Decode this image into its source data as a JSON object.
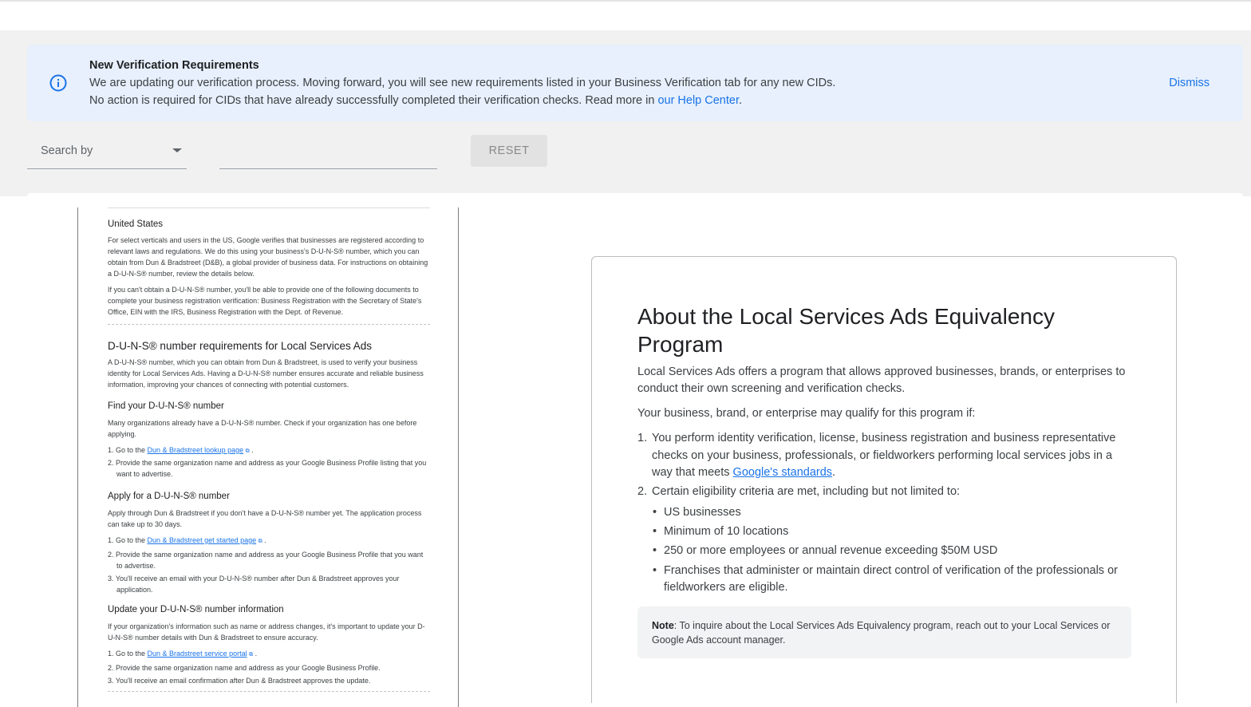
{
  "banner": {
    "title": "New Verification Requirements",
    "line1": "We are updating our verification process. Moving forward, you will see new requirements listed in your Business Verification tab for any new CIDs.",
    "line2_prefix": "No action is required for CIDs that have already successfully completed their verification checks. Read more in ",
    "line2_link": "our Help Center",
    "line2_suffix": ".",
    "dismiss": "Dismiss"
  },
  "search": {
    "searchby_label": "Search by",
    "reset_label": "RESET"
  },
  "doc": {
    "us_heading": "United States",
    "us_p1": "For select verticals and users in the US, Google verifies that businesses are registered according to relevant laws and regulations. We do this using your business's D-U-N-S® number, which you can obtain from Dun & Bradstreet (D&B), a global provider of business data. For instructions on obtaining a D-U-N-S® number, review the details below.",
    "us_p2": "If you can't obtain a D-U-N-S® number, you'll be able to provide one of the following documents to complete your business registration verification: Business Registration with the Secretary of State's Office, EIN with the IRS, Business Registration with the Dept. of Revenue.",
    "duns_heading": "D-U-N-S® number requirements for Local Services Ads",
    "duns_p": "A D-U-N-S® number, which you can obtain from Dun & Bradstreet, is used to verify your business identity for Local Services Ads. Having a D-U-N-S® number ensures accurate and reliable business information, improving your chances of connecting with potential customers.",
    "find_heading": "Find your D-U-N-S® number",
    "find_p": "Many organizations already have a D-U-N-S® number. Check if your organization has one before applying.",
    "find_steps": {
      "s1_prefix": "1. Go to the ",
      "s1_link": "Dun & Bradstreet lookup page",
      "s1_suffix": " .",
      "s2": "2. Provide the same organization name and address as your Google Business Profile listing that you want to advertise."
    },
    "apply_heading": "Apply for a D-U-N-S® number",
    "apply_p": "Apply through Dun & Bradstreet if you don't have a D-U-N-S® number yet. The application process can take up to 30 days.",
    "apply_steps": {
      "s1_prefix": "1. Go to the ",
      "s1_link": "Dun & Bradstreet get started page",
      "s1_suffix": " .",
      "s2": "2. Provide the same organization name and address as your Google Business Profile that you want to advertise.",
      "s3": "3. You'll receive an email with your D-U-N-S® number after Dun & Bradstreet approves your application."
    },
    "update_heading": "Update your D-U-N-S® number information",
    "update_p": "If your organization's information such as name or address changes, it's important to update your D-U-N-S® number details with Dun & Bradstreet to ensure accuracy.",
    "update_steps": {
      "s1_prefix": "1. Go to the ",
      "s1_link": "Dun & Bradstreet service portal",
      "s1_suffix": " .",
      "s2": "2. Provide the same organization name and address as your Google Business Profile.",
      "s3": "3. You'll receive an email confirmation after Dun & Bradstreet approves the update."
    }
  },
  "card": {
    "title": "About the Local Services Ads Equivalency Program",
    "p1": "Local Services Ads offers a program that allows approved businesses, brands, or enterprises to conduct their own screening and verification checks.",
    "p2": "Your business, brand, or enterprise may qualify for this program if:",
    "item1_num": "1.",
    "item1_text": "You perform identity verification, license, business registration and business representative checks on your business, professionals, or fieldworkers performing local services jobs in a way that meets ",
    "item1_link": "Google's standards",
    "item1_suffix": ".",
    "item2_num": "2.",
    "item2_text": "Certain eligibility criteria are met, including but not limited to:",
    "bullets": [
      "US businesses",
      "Minimum of 10 locations",
      "250 or more employees or annual revenue exceeding $50M USD",
      "Franchises that administer or maintain direct control of verification of the professionals or fieldworkers are eligible."
    ],
    "note_label": "Note",
    "note_text": ": To inquire about the Local Services Ads Equivalency program, reach out to your Local Services or Google Ads account manager."
  }
}
